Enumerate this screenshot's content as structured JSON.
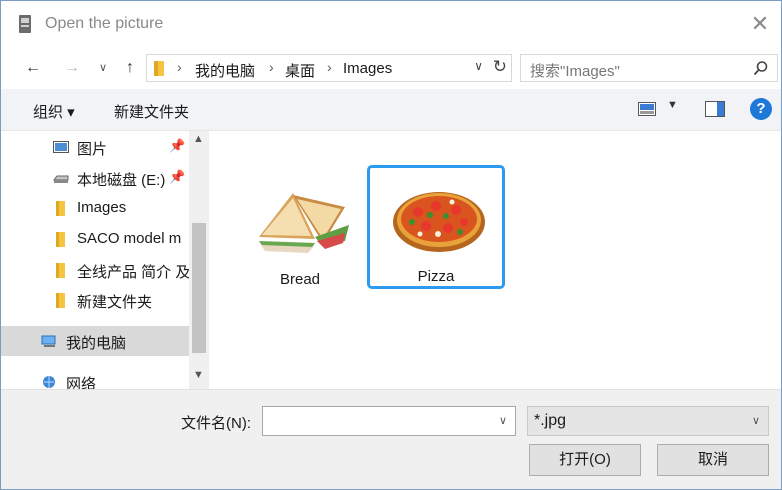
{
  "window": {
    "title": "Open the picture"
  },
  "navigation": {
    "breadcrumbs": [
      "我的电脑",
      "桌面",
      "Images"
    ],
    "search_placeholder": "搜索\"Images\""
  },
  "toolbar": {
    "organize_label": "组织 ▾",
    "new_folder_label": "新建文件夹"
  },
  "sidebar": {
    "items": [
      {
        "label": "图片",
        "icon": "pictures-icon",
        "pinned": true
      },
      {
        "label": "本地磁盘 (E:)",
        "icon": "drive-icon",
        "pinned": true
      },
      {
        "label": "Images",
        "icon": "folder-icon",
        "pinned": false
      },
      {
        "label": "SACO model m",
        "icon": "folder-icon",
        "pinned": false
      },
      {
        "label": "全线产品 简介 及",
        "icon": "folder-icon",
        "pinned": false
      },
      {
        "label": "新建文件夹",
        "icon": "folder-icon",
        "pinned": false
      }
    ],
    "this_pc_label": "我的电脑",
    "network_label": "网络"
  },
  "files": [
    {
      "name": "Bread",
      "thumbnail": "sandwich-thumbnail",
      "selected": false
    },
    {
      "name": "Pizza",
      "thumbnail": "pizza-thumbnail",
      "selected": true
    }
  ],
  "footer": {
    "filename_label": "文件名(N):",
    "filename_value": "",
    "filter_value": "*.jpg",
    "open_button": "打开(O)",
    "cancel_button": "取消"
  },
  "colors": {
    "selection_border": "#2b9bf0",
    "help_blue": "#1e78d7",
    "folder_yellow": "#f4c542"
  }
}
